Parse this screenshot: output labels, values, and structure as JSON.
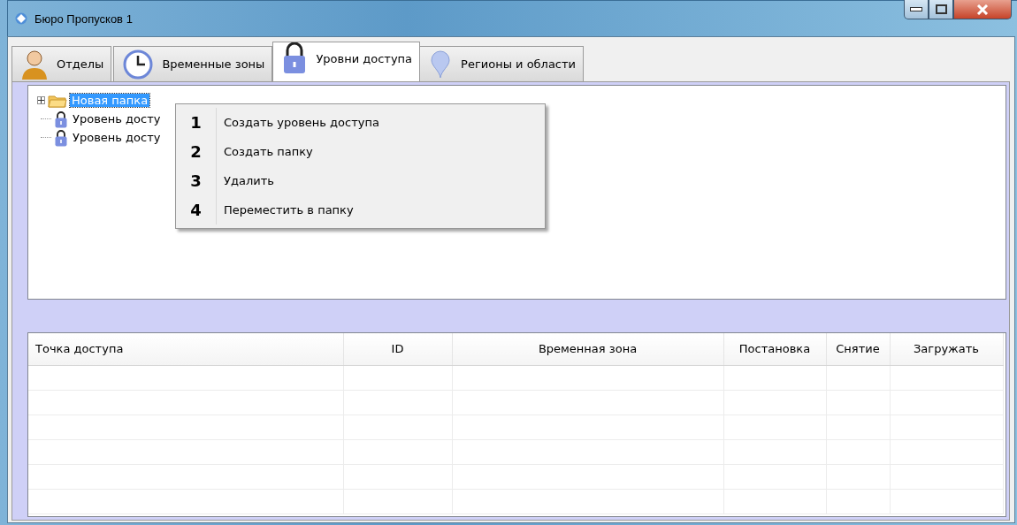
{
  "window": {
    "title": "Бюро Пропусков 1"
  },
  "tabs": [
    {
      "label": "Отделы",
      "selected": false
    },
    {
      "label": "Временные зоны",
      "selected": false
    },
    {
      "label": "Уровни доступа",
      "selected": true
    },
    {
      "label": "Регионы и области",
      "selected": false
    }
  ],
  "tree": {
    "items": [
      {
        "label": "Новая папка",
        "kind": "folder",
        "expanded": false,
        "selected": true
      },
      {
        "label": "Уровень досту",
        "kind": "level",
        "selected": false
      },
      {
        "label": "Уровень досту",
        "kind": "level",
        "selected": false
      }
    ]
  },
  "context_menu": {
    "items": [
      {
        "number": "1",
        "label": "Создать уровень доступа"
      },
      {
        "number": "2",
        "label": "Создать папку"
      },
      {
        "number": "3",
        "label": "Удалить"
      },
      {
        "number": "4",
        "label": "Переместить в папку"
      }
    ]
  },
  "table": {
    "columns": [
      "Точка доступа",
      "ID",
      "Временная зона",
      "Постановка",
      "Снятие",
      "Загружать"
    ]
  }
}
